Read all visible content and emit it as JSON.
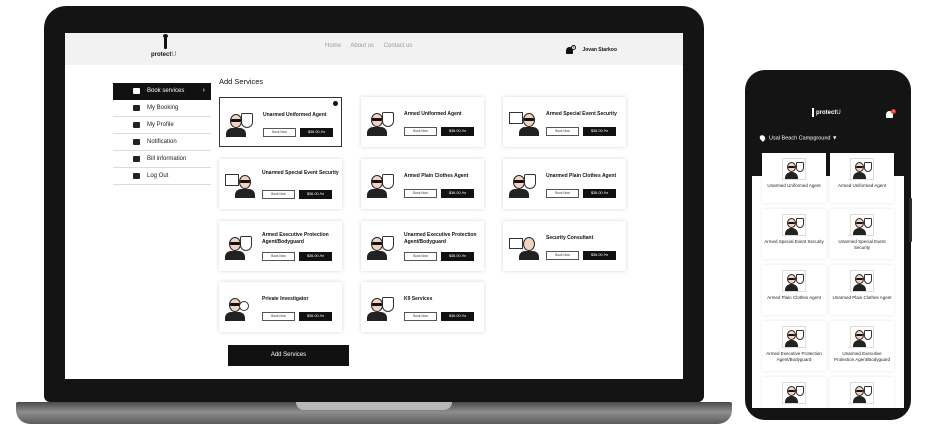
{
  "header": {
    "logo": {
      "brand": "protect",
      "suffix": "U"
    },
    "nav": [
      "Home",
      "About us",
      "Contact us"
    ],
    "user": {
      "notification_count": "2",
      "name": "Jovan Starkoo"
    }
  },
  "sidebar": {
    "items": [
      {
        "label": "Book services",
        "icon": "grid-icon",
        "active": true
      },
      {
        "label": "My Booking",
        "icon": "booking-icon"
      },
      {
        "label": "My Profile",
        "icon": "user-icon"
      },
      {
        "label": "Notification",
        "icon": "bell-icon"
      },
      {
        "label": "Bill information",
        "icon": "bill-icon"
      },
      {
        "label": "Log Out",
        "icon": "logout-icon"
      }
    ],
    "chevron": "›"
  },
  "content": {
    "title": "Add Services",
    "book_label": "Book Now",
    "services": [
      {
        "name": "Unarmed Uniformed Agent",
        "price": "$36.00 /hr",
        "selected": true
      },
      {
        "name": "Armed Uniformed Agent",
        "price": "$36.00 /hr"
      },
      {
        "name": "Armed Special Event Security",
        "price": "$36.00 /hr"
      },
      {
        "name": "Unarmed Special Event Security",
        "price": "$36.00 /hr"
      },
      {
        "name": "Armed Plain Clothes Agent",
        "price": "$36.00 /hr"
      },
      {
        "name": "Unarmed Plain Clothes Agent",
        "price": "$36.00 /hr"
      },
      {
        "name": "Armed Executive Protection Agent/Bodyguard",
        "price": "$36.00 /hr"
      },
      {
        "name": "Unarmed Executive Protection Agent/Bodyguard",
        "price": "$36.00 /hr"
      },
      {
        "name": "Security Consultant",
        "price": "$36.00 /hr"
      },
      {
        "name": "Private Investigator",
        "price": "$36.00 /hr"
      },
      {
        "name": "K9 Services",
        "price": "$36.00 /hr"
      }
    ],
    "add_button": "Add Services"
  },
  "phone": {
    "logo": {
      "brand": "protect",
      "suffix": "U"
    },
    "notification_count": "2",
    "location": "Usal Beach Campground ▼",
    "services": [
      "Unarmed Uniformed Agent",
      "Armed Uniformed Agent",
      "Armed Special Event Security",
      "Unarmed Special Event Security",
      "Armed Plain Clothes Agent",
      "Unarmed Plain Clothes Agent",
      "Armed Executive Protection Agent/Bodyguard",
      "Unarmed Executive Protection Agent/Bodyguard",
      "",
      ""
    ]
  },
  "colors": {
    "primary": "#111111",
    "header_bg": "#f2f2f2",
    "badge_red": "#e53935"
  }
}
